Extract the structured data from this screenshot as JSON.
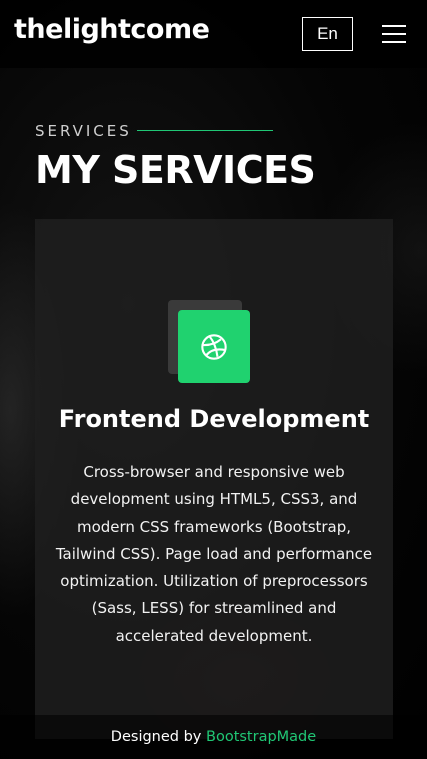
{
  "header": {
    "logo": "thelightcome",
    "language_button": "En",
    "menu_icon": "hamburger-menu-icon"
  },
  "section": {
    "label": "SERVICES",
    "title": "MY SERVICES"
  },
  "service_card": {
    "icon": "dribbble-icon",
    "title": "Frontend Development",
    "description": "Cross-browser and responsive web development using HTML5, CSS3, and modern CSS frameworks (Bootstrap, Tailwind CSS). Page load and performance optimization. Utilization of preprocessors (Sass, LESS) for streamlined and accelerated development."
  },
  "footer": {
    "designed_by": "Designed by",
    "link_text": "BootstrapMade"
  },
  "colors": {
    "accent": "#20c775",
    "icon_bg": "#20d26f",
    "card_bg": "#1e1e1e",
    "page_bg": "#000000"
  }
}
